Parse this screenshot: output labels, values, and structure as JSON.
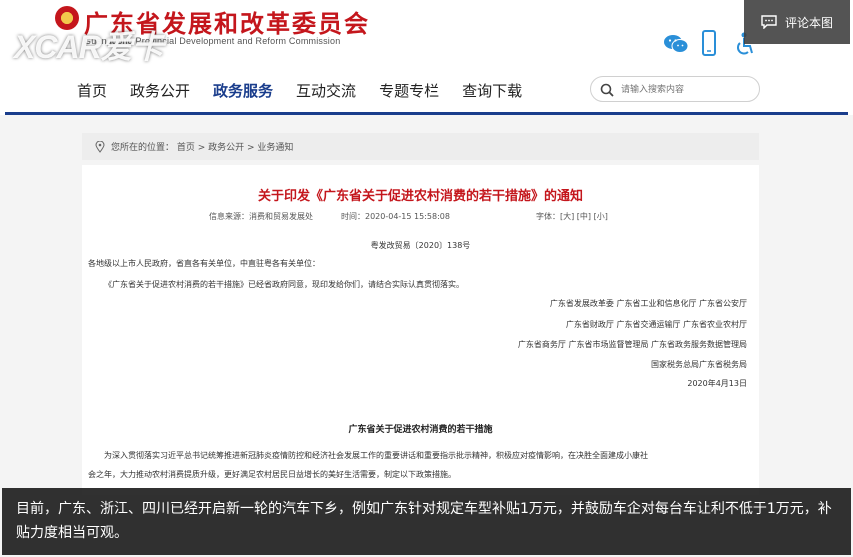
{
  "header": {
    "site_title": "广东省发展和改革委员会",
    "site_subtitle": "Guangdong Provincial Development and Reform Commission",
    "watermark": "XCAR爱卡"
  },
  "overlay": {
    "comment_label": "评论本图"
  },
  "nav": {
    "items": [
      {
        "label": "首页",
        "active": false
      },
      {
        "label": "政务公开",
        "active": false
      },
      {
        "label": "政务服务",
        "active": true
      },
      {
        "label": "互动交流",
        "active": false
      },
      {
        "label": "专题专栏",
        "active": false
      },
      {
        "label": "查询下载",
        "active": false
      }
    ],
    "search_placeholder": "请输入搜索内容"
  },
  "breadcrumb": {
    "text": "您所在的位置：  首页 > 政务公开 > 业务通知"
  },
  "article": {
    "title": "关于印发《广东省关于促进农村消费的若干措施》的通知",
    "source": "信息来源：消费和贸易发展处",
    "time": "时间：2020-04-15 15:58:08",
    "font_size": "字体：[大] [中] [小]",
    "doc_number": "粤发改贸易〔2020〕138号",
    "salutation": "各地级以上市人民政府，省直各有关单位，中直驻粤各有关单位：",
    "body": "《广东省关于促进农村消费的若干措施》已经省政府同意，现印发给你们，请结合实际认真贯彻落实。",
    "signatories": [
      "广东省发展改革委  广东省工业和信息化厅  广东省公安厅",
      "广东省财政厅    广东省交通运输厅    广东省农业农村厅",
      "广东省商务厅  广东省市场监督管理局  广东省政务服务数据管理局",
      "国家税务总局广东省税务局"
    ],
    "date": "2020年4月13日",
    "section_title": "广东省关于促进农村消费的若干措施",
    "para1_line1": "为深入贯彻落实习近平总书记统筹推进新冠肺炎疫情防控和经济社会发展工作的重要讲话和重要指示批示精神，积极应对疫情影响，在决胜全面建成小康社",
    "para1_line2": "会之年，大力推动农村消费提质升级，更好满足农村居民日益增长的美好生活需要，制定以下政策措施。"
  },
  "caption": {
    "text": "目前，广东、浙江、四川已经开启新一轮的汽车下乡，例如广东针对规定车型补贴1万元，并鼓励车企对每台车让利不低于1万元，补贴力度相当可观。"
  },
  "colors": {
    "brand_red": "#c4161c",
    "nav_blue": "#1a3d8c",
    "wechat_blue": "#2a8fd8"
  }
}
